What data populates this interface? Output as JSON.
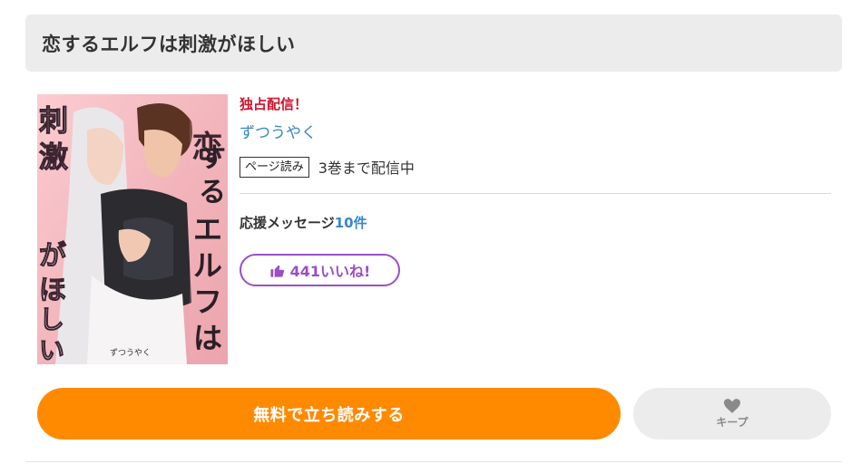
{
  "title": "恋するエルフは刺激がほしい",
  "cover": {
    "title_text": "恋するエルフは刺激がほしい",
    "author_text": "ずつうやく"
  },
  "info": {
    "exclusive_label": "独占配信！",
    "author": "ずつうやく",
    "format_badge": "ページ読み",
    "availability": "3巻まで配信中",
    "support_label": "応援メッセージ",
    "support_count": "10件",
    "likes_label": "441いいね!"
  },
  "actions": {
    "read_free_label": "無料で立ち読みする",
    "keep_label": "キープ"
  },
  "colors": {
    "accent_orange": "#ff8a00",
    "exclusive_red": "#d0112b",
    "link_blue": "#3a86c8",
    "like_purple": "#9b4ec6"
  },
  "icons": {
    "like": "thumbs-up-icon",
    "keep": "heart-icon"
  }
}
